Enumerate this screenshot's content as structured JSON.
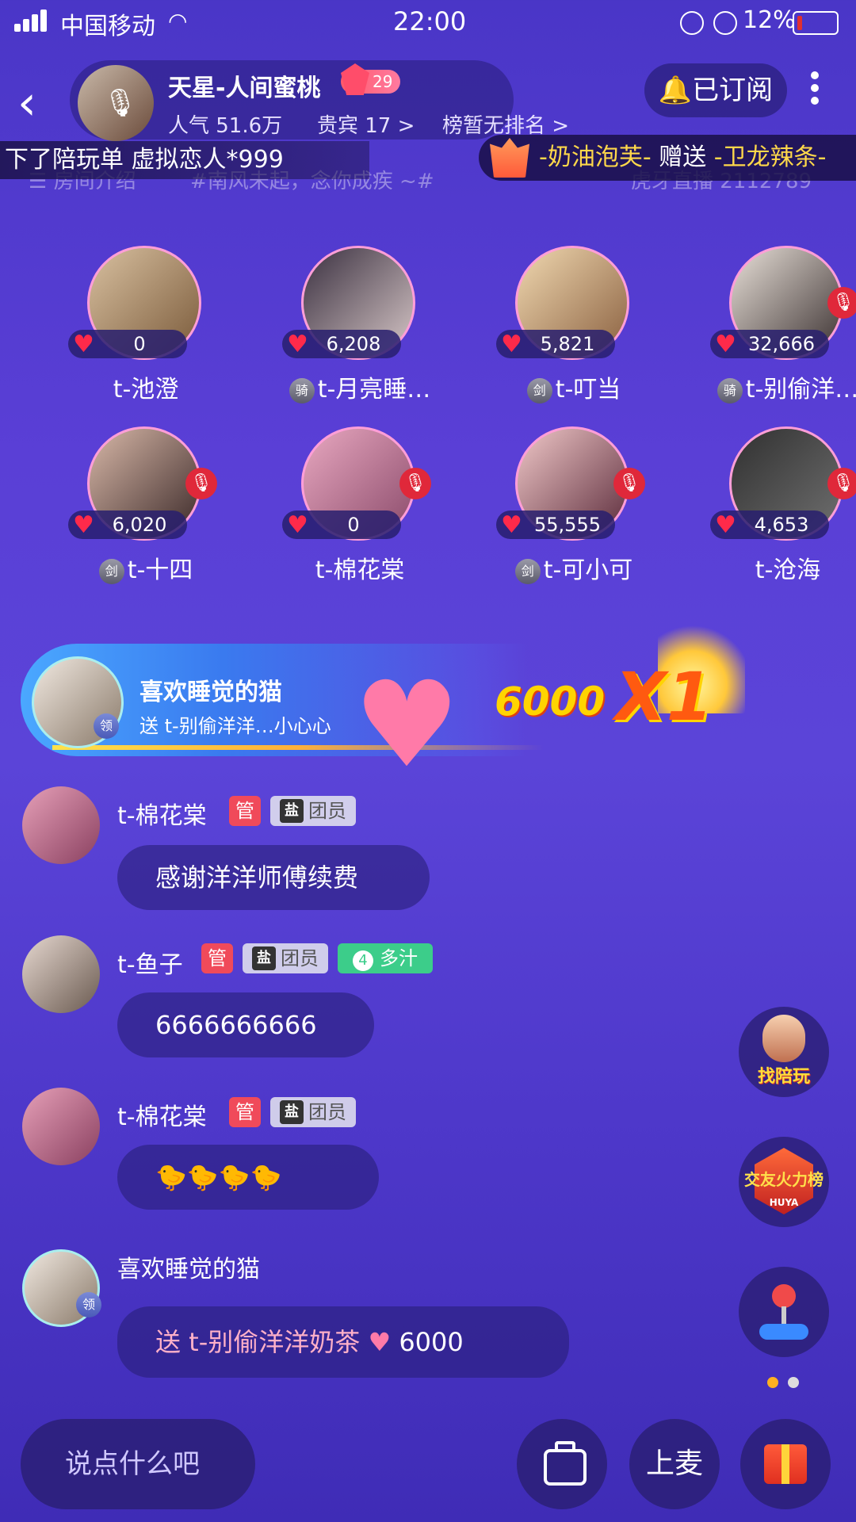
{
  "status_bar": {
    "carrier": "中国移动",
    "time": "22:00",
    "battery": "12%"
  },
  "header": {
    "host_name": "天星-人间蜜桃",
    "level": "29",
    "popularity": "人气 51.6万",
    "guests": "贵宾 17 >",
    "rank": "榜暂无排名 >",
    "subscribe_label": "已订阅"
  },
  "marquee": "下了陪玩单 虚拟恋人*999",
  "gift_broadcast": {
    "sender": "-奶油泡芙-",
    "verb": "赠送",
    "receiver": "-卫龙辣条-"
  },
  "room_info": {
    "intro": "房间介绍",
    "topic": "#南风未起，念你成疾 ~#",
    "room_id": "虎牙直播 2112789"
  },
  "seats": [
    {
      "name": "t-池澄",
      "count": "0",
      "badge": "",
      "mic_off": false
    },
    {
      "name": "t-月亮睡…",
      "count": "6,208",
      "badge": "骑",
      "mic_off": false
    },
    {
      "name": "t-叮当",
      "count": "5,821",
      "badge": "剑",
      "mic_off": false
    },
    {
      "name": "t-别偷洋…",
      "count": "32,666",
      "badge": "骑",
      "mic_off": true
    },
    {
      "name": "t-十四",
      "count": "6,020",
      "badge": "剑",
      "mic_off": true
    },
    {
      "name": "t-棉花棠",
      "count": "0",
      "badge": "",
      "mic_off": true
    },
    {
      "name": "t-可小可",
      "count": "55,555",
      "badge": "剑",
      "mic_off": true
    },
    {
      "name": "t-沧海",
      "count": "4,653",
      "badge": "",
      "mic_off": true
    }
  ],
  "gift_effect": {
    "user": "喜欢睡觉的猫",
    "text": "送 t-别偷洋洋…小心心",
    "value": "6000",
    "combo": "X1",
    "badge": "领"
  },
  "chat": [
    {
      "name": "t-棉花棠",
      "admin": "管",
      "member_tag": "盐",
      "member_label": "团员",
      "message": "感谢洋洋师傅续费"
    },
    {
      "name": "t-鱼子",
      "admin": "管",
      "member_tag": "盐",
      "member_label": "团员",
      "fan_level": "4",
      "fan_label": "多汁",
      "message": "6666666666"
    },
    {
      "name": "t-棉花棠",
      "admin": "管",
      "member_tag": "盐",
      "member_label": "团员",
      "message": "🐤🐤🐤🐤"
    },
    {
      "name": "喜欢睡觉的猫",
      "badge": "领",
      "message": "送 t-别偷洋洋奶茶",
      "gift_value": "6000"
    }
  ],
  "widgets": {
    "find_companion": "找陪玩",
    "fire_rank": "交友火力榜",
    "fire_rank_sub": "HUYA"
  },
  "bottom": {
    "input_placeholder": "说点什么吧",
    "mic_label": "上麦"
  },
  "colors": {
    "accent_pink": "#ff9ed8",
    "admin_red": "#f04a5a",
    "fan_green": "#3ccd8a",
    "highlight_yellow": "#ffd84a"
  }
}
